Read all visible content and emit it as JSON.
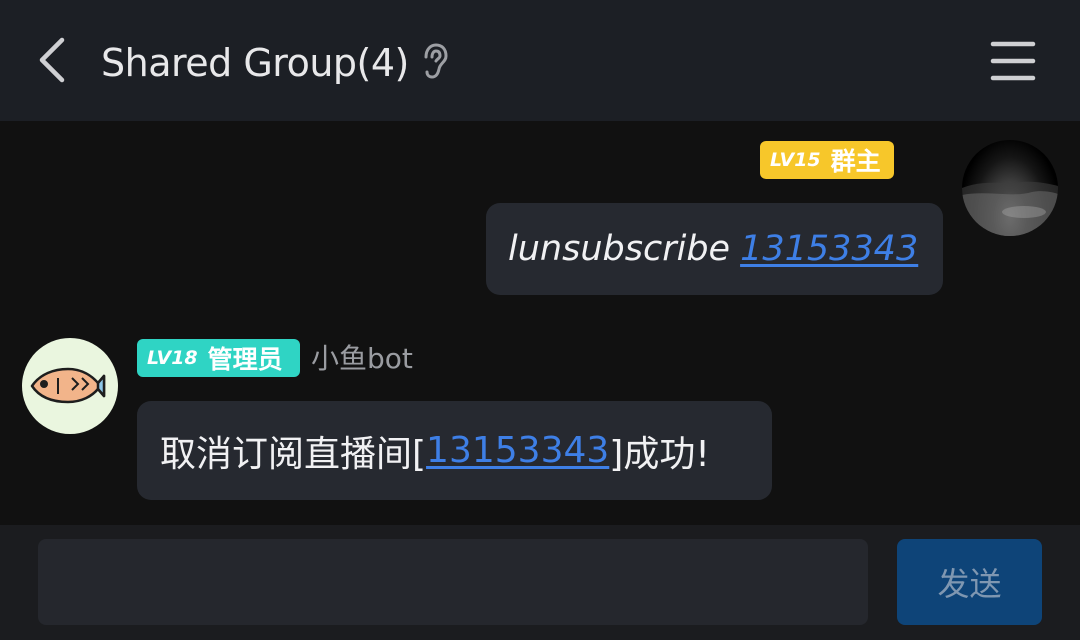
{
  "header": {
    "title": "Shared Group(4)",
    "back_icon": "chevron-left-icon",
    "listen_icon": "ear-icon",
    "menu_icon": "hamburger-menu-icon"
  },
  "messages": [
    {
      "sender": "self",
      "badge": {
        "level": "LV15",
        "role": "群主",
        "color": "#f7c72a"
      },
      "text_prefix": "lunsubscribe",
      "link_text": "13153343"
    },
    {
      "sender": "小鱼bot",
      "badge": {
        "level": "LV18",
        "role": "管理员",
        "color": "#2fd4c4"
      },
      "text_prefix": "取消订阅直播间[",
      "link_text": "13153343",
      "text_suffix": "]成功!"
    }
  ],
  "composer": {
    "input_value": "",
    "send_label": "发送"
  },
  "colors": {
    "link": "#3e7fe6",
    "send_button": "#0e4478",
    "bubble": "#262930"
  }
}
